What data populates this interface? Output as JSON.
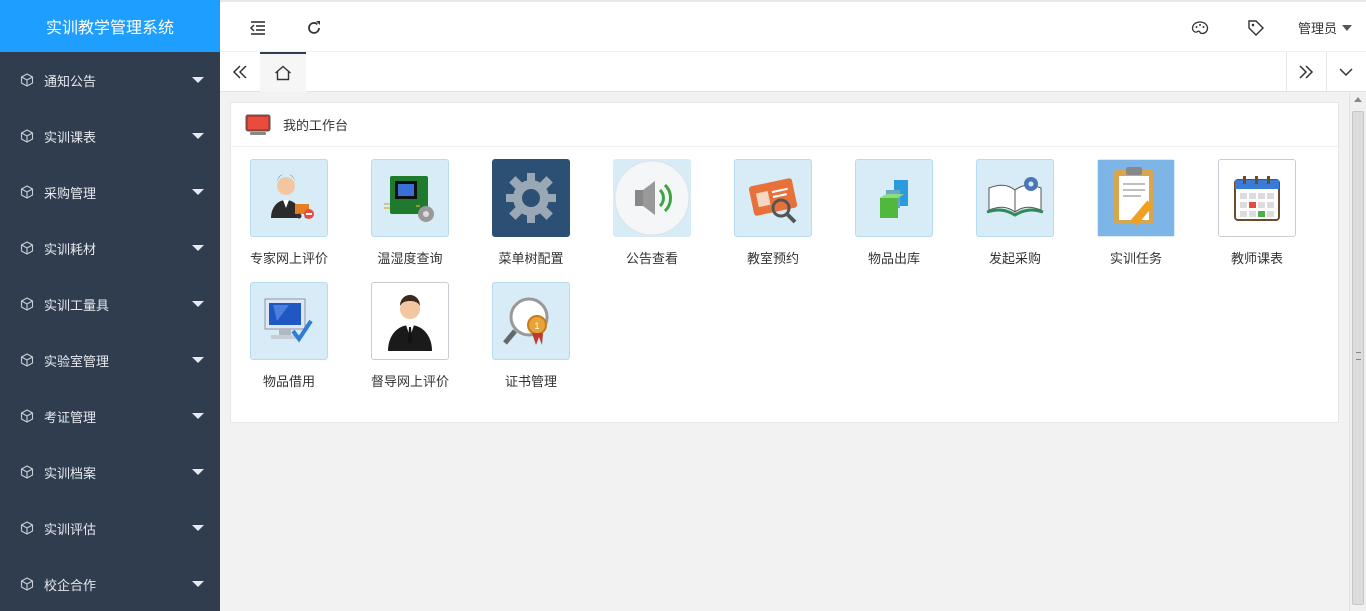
{
  "app": {
    "title": "实训教学管理系统"
  },
  "colors": {
    "brand": "#1e9fff",
    "sidebar": "#2f3d4f"
  },
  "sidebar": {
    "items": [
      {
        "label": "通知公告"
      },
      {
        "label": "实训课表"
      },
      {
        "label": "采购管理"
      },
      {
        "label": "实训耗材"
      },
      {
        "label": "实训工量具"
      },
      {
        "label": "实验室管理"
      },
      {
        "label": "考证管理"
      },
      {
        "label": "实训档案"
      },
      {
        "label": "实训评估"
      },
      {
        "label": "校企合作"
      }
    ]
  },
  "header": {
    "user": "管理员"
  },
  "workspace": {
    "title": "我的工作台",
    "tiles": [
      {
        "label": "专家网上评价",
        "icon": "expert-icon"
      },
      {
        "label": "温湿度查询",
        "icon": "chip-icon"
      },
      {
        "label": "菜单树配置",
        "icon": "gear-icon"
      },
      {
        "label": "公告查看",
        "icon": "speaker-icon"
      },
      {
        "label": "教室预约",
        "icon": "id-card-icon"
      },
      {
        "label": "物品出库",
        "icon": "blocks-icon"
      },
      {
        "label": "发起采购",
        "icon": "book-gear-icon"
      },
      {
        "label": "实训任务",
        "icon": "clipboard-icon"
      },
      {
        "label": "教师课表",
        "icon": "calendar-icon"
      },
      {
        "label": "物品借用",
        "icon": "monitor-check-icon"
      },
      {
        "label": "督导网上评价",
        "icon": "supervisor-icon"
      },
      {
        "label": "证书管理",
        "icon": "medal-magnifier-icon"
      }
    ]
  }
}
